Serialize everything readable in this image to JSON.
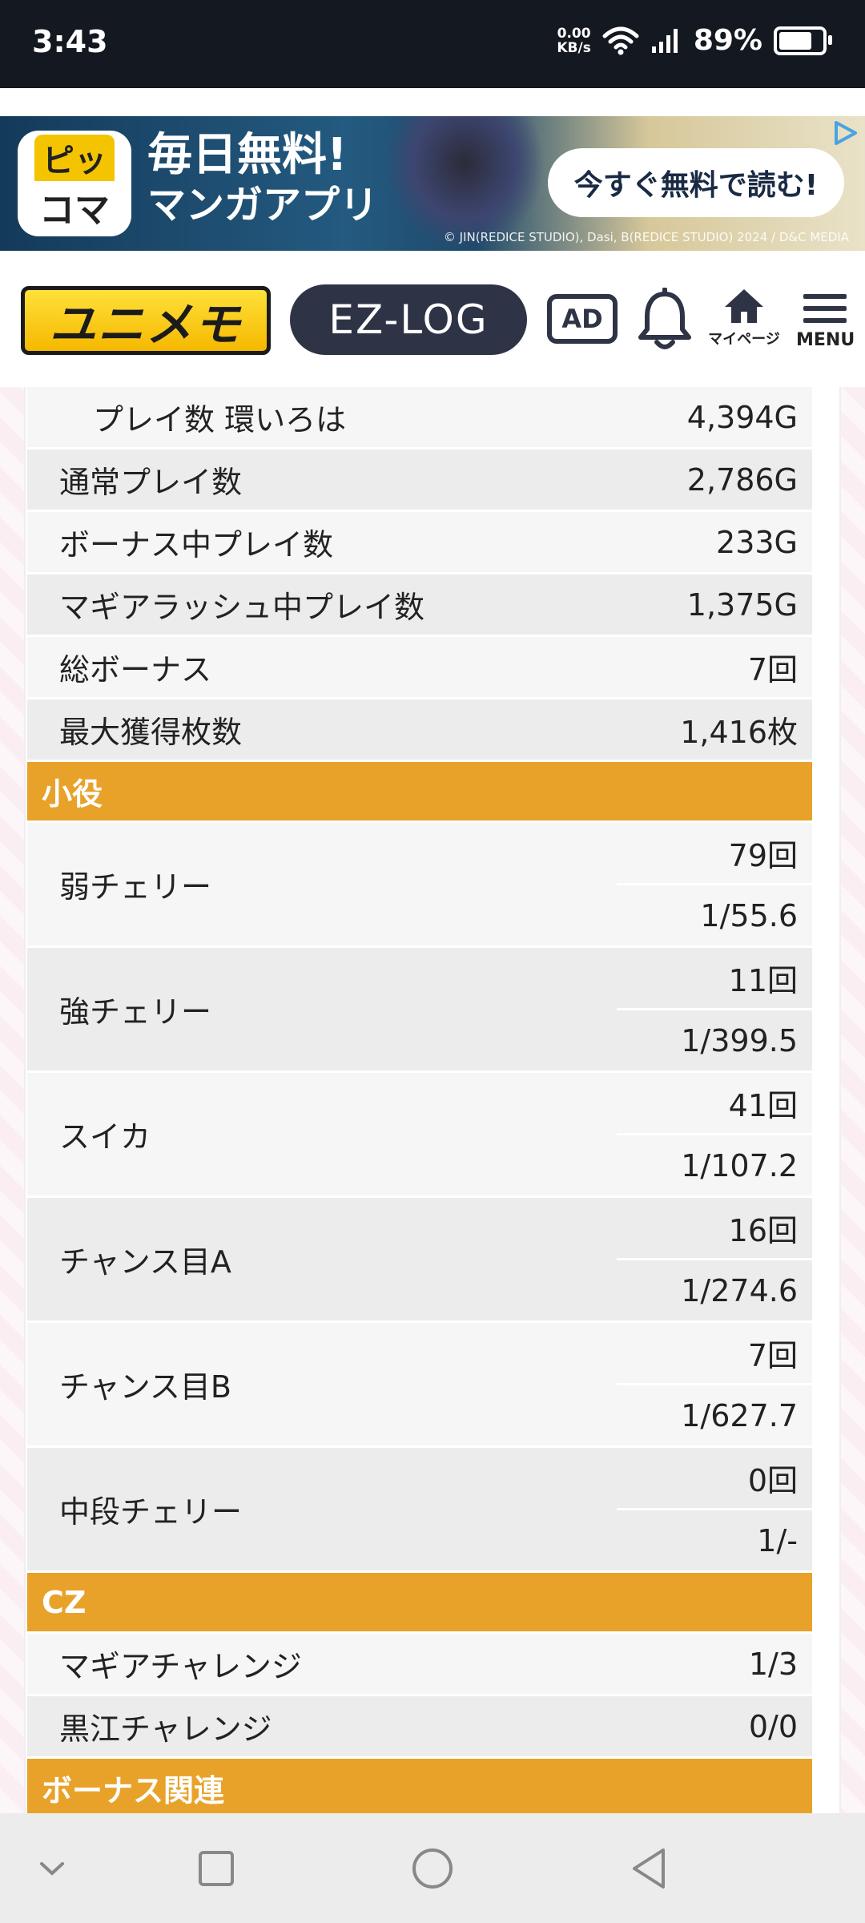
{
  "status_bar": {
    "time": "3:43",
    "net_speed_value": "0.00",
    "net_speed_unit": "KB/s",
    "battery_percent": "89%"
  },
  "ad_banner": {
    "logo_line1": "ピッ",
    "logo_line2": "コマ",
    "title_line1": "毎日無料!",
    "title_line2": "マンガアプリ",
    "cta": "今すぐ無料で読む!",
    "copyright": "© JIN(REDICE STUDIO), Dasi, B(REDICE STUDIO) 2024 / D&C MEDIA"
  },
  "header": {
    "logo_text": "ユニメモ",
    "ezlog_label": "EZ-LOG",
    "ad_label": "AD",
    "mypage_label": "マイページ",
    "menu_label": "MENU"
  },
  "stats": {
    "rows": [
      {
        "label": "プレイ数 環いろは",
        "value": "4,394G"
      },
      {
        "label": "通常プレイ数",
        "value": "2,786G"
      },
      {
        "label": "ボーナス中プレイ数",
        "value": "233G"
      },
      {
        "label": "マギアラッシュ中プレイ数",
        "value": "1,375G"
      },
      {
        "label": "総ボーナス",
        "value": "7回"
      },
      {
        "label": "最大獲得枚数",
        "value": "1,416枚"
      }
    ]
  },
  "koyaku": {
    "section_title": "小役",
    "rows": [
      {
        "label": "弱チェリー",
        "count": "79回",
        "prob": "1/55.6"
      },
      {
        "label": "強チェリー",
        "count": "11回",
        "prob": "1/399.5"
      },
      {
        "label": "スイカ",
        "count": "41回",
        "prob": "1/107.2"
      },
      {
        "label": "チャンス目A",
        "count": "16回",
        "prob": "1/274.6"
      },
      {
        "label": "チャンス目B",
        "count": "7回",
        "prob": "1/627.7"
      },
      {
        "label": "中段チェリー",
        "count": "0回",
        "prob": "1/-"
      }
    ]
  },
  "cz": {
    "section_title": "CZ",
    "rows": [
      {
        "label": "マギアチャレンジ",
        "value": "1/3"
      },
      {
        "label": "黒江チャレンジ",
        "value": "0/0"
      }
    ]
  },
  "bonus_section": {
    "section_title": "ボーナス関連"
  },
  "colors": {
    "section_header": "#e8a22a",
    "row_light": "#f6f6f6",
    "row_dark": "#ececec",
    "status_bar": "#141821",
    "navy": "#2e3446"
  }
}
